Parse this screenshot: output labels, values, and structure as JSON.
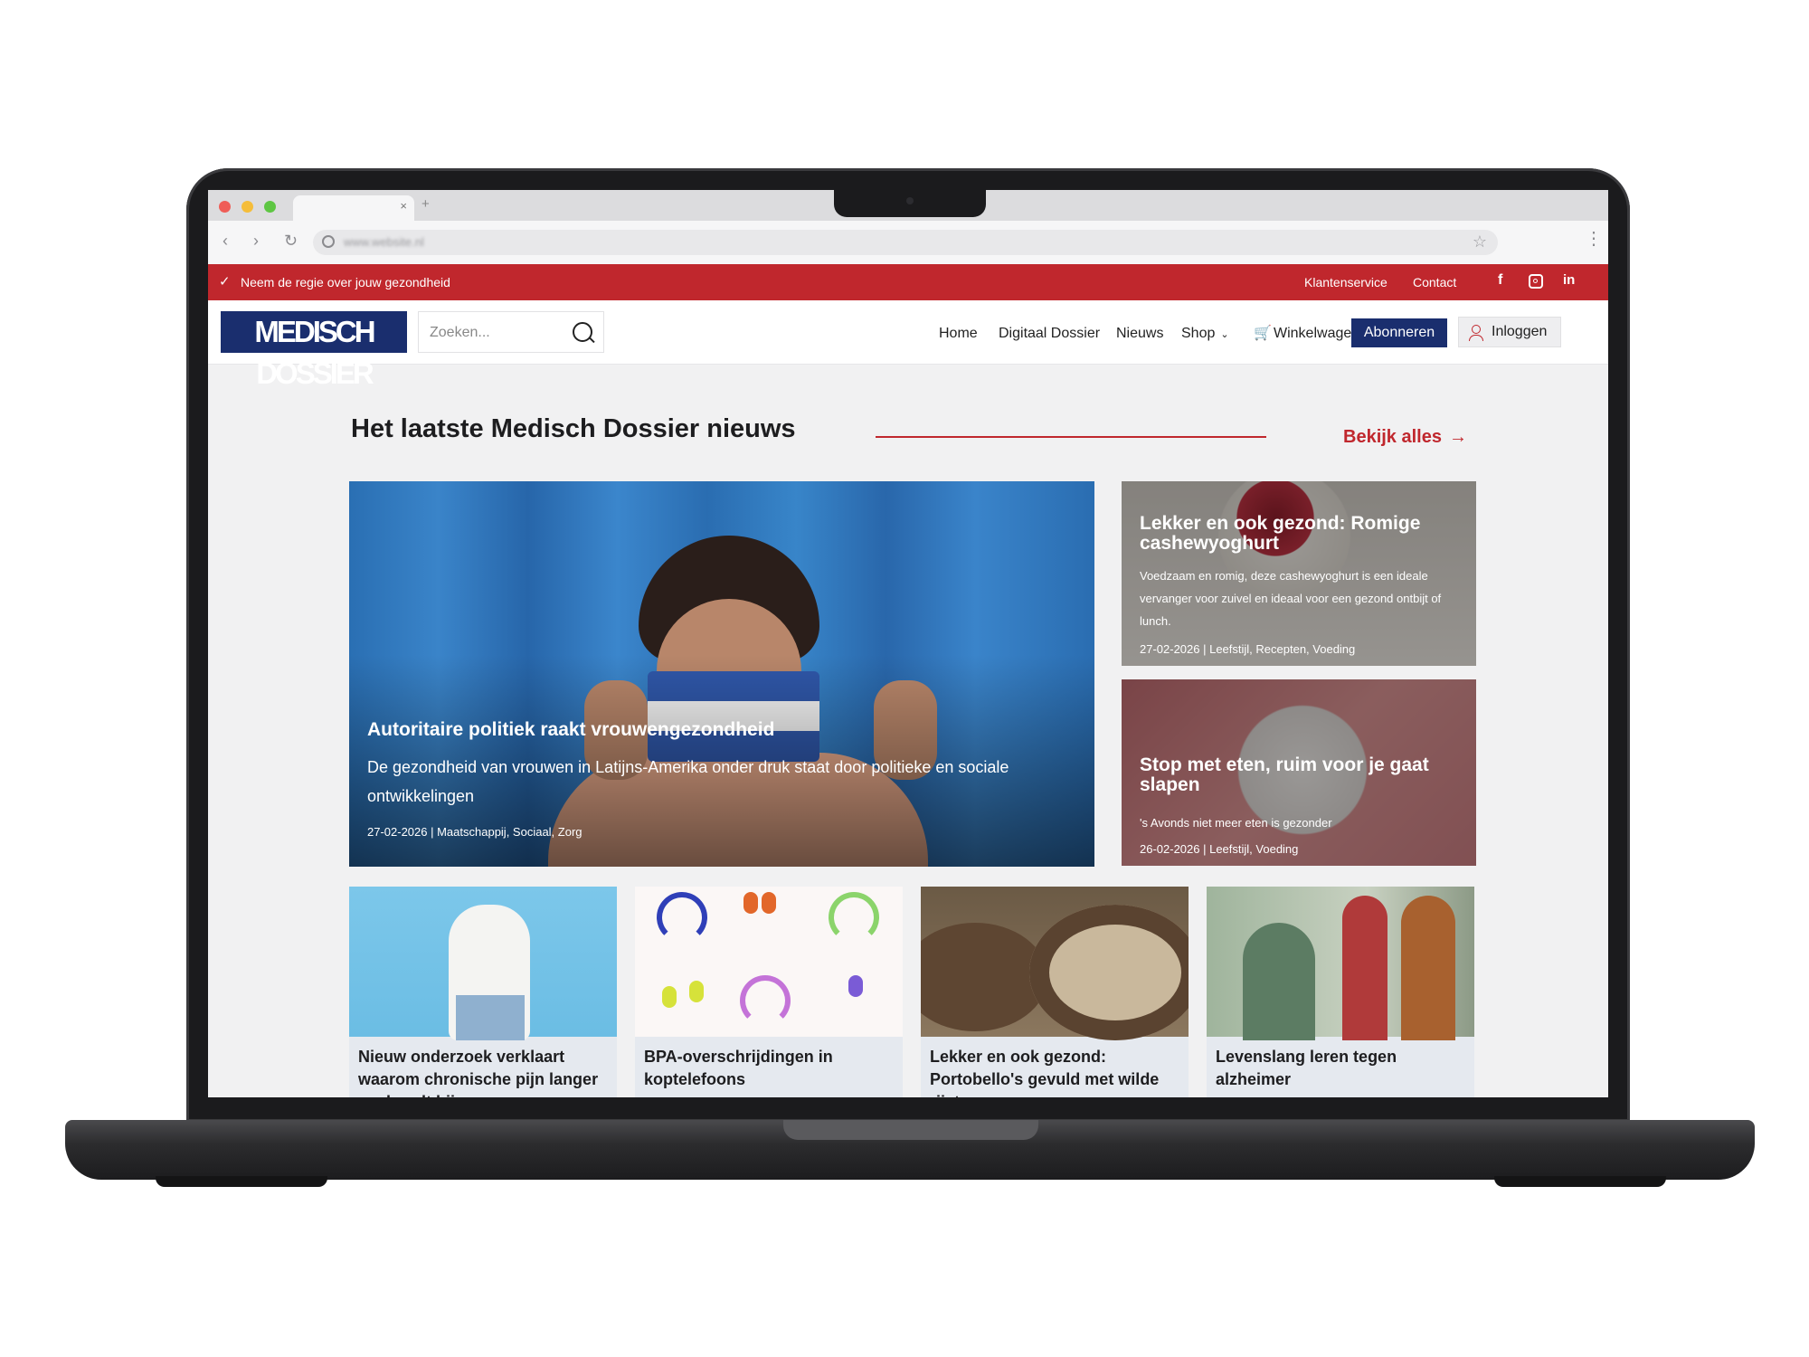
{
  "browser": {
    "tab_close": "×",
    "tab_new": "+",
    "url": "www.website.nl",
    "icons": [
      "back-icon",
      "forward-icon",
      "reload-icon",
      "search-icon",
      "star-icon",
      "kebab-menu-icon"
    ]
  },
  "topbar": {
    "check_glyph": "✓",
    "tagline": "Neem de regie over jouw gezondheid",
    "links": [
      "Klantenservice",
      "Contact"
    ],
    "social": {
      "facebook": "f",
      "linkedin": "in"
    },
    "color": "#c0272d"
  },
  "header": {
    "logo_text": "MEDISCH DOSSIER",
    "search_placeholder": "Zoeken...",
    "nav": {
      "home": "Home",
      "digital": "Digitaal Dossier",
      "news": "Nieuws",
      "shop": "Shop",
      "shop_chevron": "⌄",
      "cart": "Winkelwagen"
    },
    "subscribe": "Abonneren",
    "login": "Inloggen",
    "brand_color": "#1a2e6e"
  },
  "section": {
    "title": "Het laatste Medisch Dossier nieuws",
    "see_all": "Bekijk alles",
    "arrow": "→"
  },
  "featured": {
    "title": "Autoritaire politiek raakt vrouwengezondheid",
    "excerpt": "De gezondheid van vrouwen in Latijns-Amerika onder druk staat door politieke en sociale ontwikkelingen",
    "meta": "27-02-2026 | Maatschappij, Sociaal, Zorg"
  },
  "side": [
    {
      "title": "Lekker en ook gezond: Romige cashewyoghurt",
      "excerpt": "Voedzaam en romig, deze cashewyoghurt is een ideale vervanger voor zuivel en ideaal voor een gezond ontbijt of lunch.",
      "meta": "27-02-2026 | Leefstijl, Recepten, Voeding"
    },
    {
      "title": "Stop met eten, ruim voor je gaat slapen",
      "excerpt": "'s Avonds niet meer eten is gezonder",
      "meta": "26-02-2026 | Leefstijl, Voeding"
    }
  ],
  "small": [
    {
      "title": "Nieuw onderzoek verklaart waarom chronische pijn langer aanhoudt bij"
    },
    {
      "title": "BPA-overschrijdingen in koptelefoons"
    },
    {
      "title": "Lekker en ook gezond: Portobello's gevuld met wilde rijst"
    },
    {
      "title": "Levenslang leren tegen alzheimer"
    }
  ]
}
